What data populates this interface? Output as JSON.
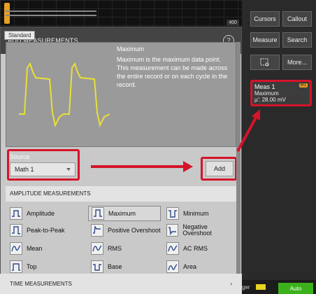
{
  "top_strip": {
    "tag": "400"
  },
  "dialog": {
    "title": "ADD MEASUREMENTS",
    "help_icon": "question-circle-icon",
    "tab": "Standard",
    "info": {
      "title": "Maximum",
      "text": "Maximum is the maximum data point. This measurement can be made across the entire record or on each cycle in the record."
    },
    "source": {
      "label": "Source",
      "value": "Math 1"
    },
    "add_label": "Add",
    "amplitude_header": "AMPLITUDE MEASUREMENTS",
    "time_header": "TIME MEASUREMENTS",
    "measurements": [
      {
        "label": "Amplitude",
        "icon": "amplitude-icon"
      },
      {
        "label": "Maximum",
        "icon": "maximum-icon",
        "selected": true
      },
      {
        "label": "Minimum",
        "icon": "minimum-icon"
      },
      {
        "label": "Peak-to-Peak",
        "icon": "peak-to-peak-icon"
      },
      {
        "label": "Positive Overshoot",
        "icon": "positive-overshoot-icon"
      },
      {
        "label": "Negative Overshoot",
        "icon": "negative-overshoot-icon"
      },
      {
        "label": "Mean",
        "icon": "mean-icon"
      },
      {
        "label": "RMS",
        "icon": "rms-icon"
      },
      {
        "label": "AC RMS",
        "icon": "ac-rms-icon"
      },
      {
        "label": "Top",
        "icon": "top-icon"
      },
      {
        "label": "Base",
        "icon": "base-icon"
      },
      {
        "label": "Area",
        "icon": "area-icon"
      }
    ]
  },
  "right_panel": {
    "buttons": [
      "Cursors",
      "Callout",
      "Measure",
      "Search",
      "",
      "More..."
    ],
    "meas_badge": {
      "title": "Meas 1",
      "channel": "M1",
      "type": "Maximum",
      "value": "µ': 28.00 mV"
    },
    "trigger_label": "ger",
    "auto_label": "Auto"
  },
  "colors": {
    "highlight": "#d4142a",
    "waveform": "#e8e034",
    "auto": "#3bb11a"
  }
}
